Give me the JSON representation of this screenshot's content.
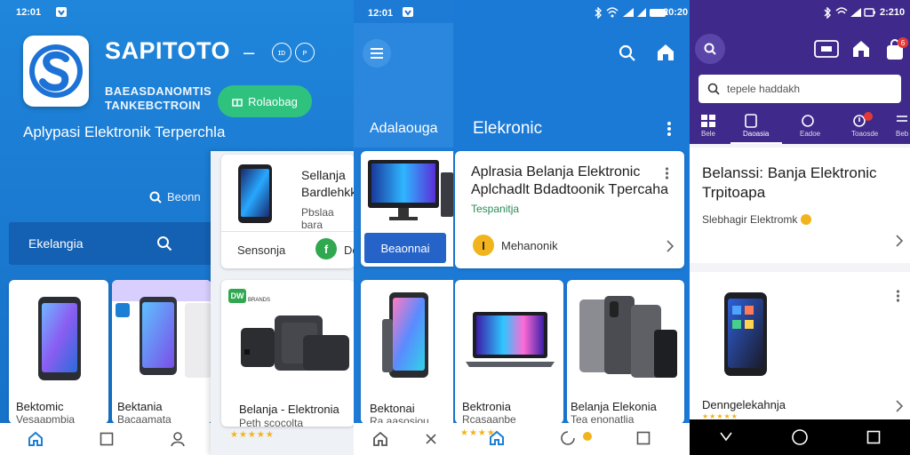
{
  "panel1": {
    "status_time": "12:01",
    "brand": "SAPITOTO",
    "brand_dash": "–",
    "circle_btn_1": "ɪᴅ",
    "circle_btn_2": "ᴘ",
    "subtitle_line1": "BAEASDANOMTIS",
    "subtitle_line2": "TANKEBCTROIN",
    "green_button": "Rolaobag",
    "tagline": "Aplypasi Elektronik Terperchla",
    "search_link": "Beonn",
    "dark_bar_label": "Ekelangia",
    "products": [
      {
        "title": "Bektomic",
        "subtitle": "Vesaapmbia"
      },
      {
        "title": "Bektania",
        "subtitle": "Bacaamata"
      }
    ],
    "nav": [
      "home-icon",
      "square-icon",
      "person-icon"
    ]
  },
  "panel2": {
    "card_title_line1": "Sellanja",
    "card_title_line2": "Bardlehkk",
    "card_subtitle": "Pbslaa bara",
    "row_label": "Sensonja",
    "row_action": "Dek",
    "product_badge": "DW",
    "product_badge_sub": "BRANDS",
    "product_title": "Belanja - Elektronia",
    "product_subtitle": "Peth scocolta",
    "stars": "★★★★★"
  },
  "panel3": {
    "status_time": "12:01",
    "header_title": "Adalaouga",
    "blue_button": "Beaonnai",
    "product_title": "Bektonai",
    "product_subtitle": "Ra aasosiou"
  },
  "panel4": {
    "header_title": "Elekronic",
    "status_time": "20:20",
    "card_title_line1": "Aplrasia Belanja Elektronic",
    "card_title_line2": "Aplchadlt Bdadtoonik Tpercaha",
    "card_subtitle": "Tespanitja",
    "row_label": "Mehanonik",
    "products": [
      {
        "title": "Bektronia",
        "subtitle": "Rcasaanbe"
      },
      {
        "title": "Belanja Elekonia",
        "subtitle": "Tea enonatlia"
      }
    ],
    "stars": "★★★★"
  },
  "panel5": {
    "status_time": "2:210",
    "badge": "6",
    "search_placeholder": "tepele haddakh",
    "tabs": [
      "Bele",
      "Daoasia",
      "Eadoe",
      "Toaosde",
      "Beb"
    ],
    "card_title_line1": "Belanssi: Banja Elektronic",
    "card_title_line2": "Trpitoapa",
    "card_subtitle": "Slebhagir Elektromk",
    "product_title": "Denngelekahnja",
    "stars": "★★★★★"
  },
  "colors": {
    "primary_blue": "#1c7fd6",
    "dark_blue": "#1460b2",
    "green": "#2ec27e",
    "purple": "#3f2a8c",
    "star": "#f2b41c"
  }
}
